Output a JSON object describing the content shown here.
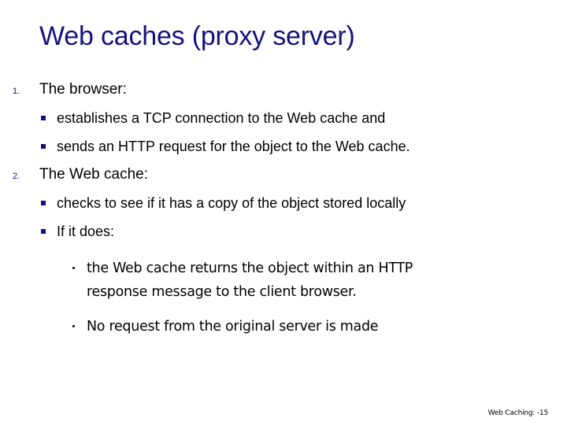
{
  "slide": {
    "title": "Web caches (proxy server)",
    "background_color": "#ffffff",
    "title_color": "#14137e",
    "bullet_color": "#12117c",
    "text_color": "#000000",
    "items": [
      {
        "number": "1.",
        "heading": "The browser:",
        "sub_bullets": [
          "establishes a TCP connection to the Web cache and",
          "sends an HTTP request for the object to the Web cache."
        ]
      },
      {
        "number": "2.",
        "heading": "The Web cache:",
        "sub_bullets": [
          "checks to see if it has a copy of the object stored locally",
          "If it does:"
        ]
      }
    ],
    "detail_bullets": [
      {
        "line1": "the Web cache returns the object within an HTTP",
        "line2": "response message to the client browser."
      },
      {
        "line1": "No request from the original server is made",
        "line2": ""
      }
    ],
    "footer": "Web Caching:  -15"
  }
}
